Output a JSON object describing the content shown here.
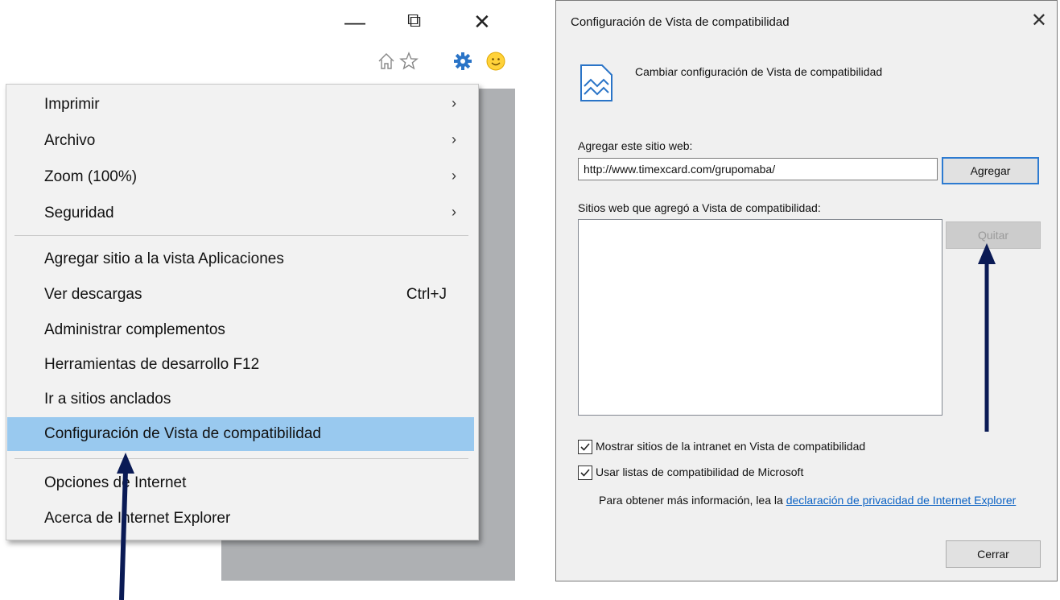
{
  "window_controls": {
    "minimize_glyph": "—",
    "restore_glyph": "⧉",
    "close_glyph": "✕"
  },
  "toolbar_icons": [
    "home-icon",
    "favorites-star-icon",
    "tools-gear-icon",
    "feedback-smiley-icon"
  ],
  "tools_menu": {
    "items": [
      {
        "label": "Imprimir",
        "submenu": "›"
      },
      {
        "label": "Archivo",
        "submenu": "›"
      },
      {
        "label": "Zoom (100%)",
        "submenu": "›"
      },
      {
        "label": "Seguridad",
        "submenu": "›"
      },
      {
        "label": "Agregar sitio a la vista Aplicaciones"
      },
      {
        "label": "Ver descargas",
        "shortcut": "Ctrl+J"
      },
      {
        "label": "Administrar complementos"
      },
      {
        "label": "Herramientas de desarrollo F12"
      },
      {
        "label": "Ir a sitios anclados"
      },
      {
        "label": "Configuración de Vista de compatibilidad",
        "highlighted": true
      },
      {
        "label": "Opciones de Internet"
      },
      {
        "label": "Acerca de Internet Explorer"
      }
    ]
  },
  "dialog": {
    "title": "Configuración de Vista de compatibilidad",
    "close_glyph": "✕",
    "header": "Cambiar configuración de Vista de compatibilidad",
    "add_label": "Agregar este sitio web:",
    "url_value": "http://www.timexcard.com/grupomaba/",
    "add_button": "Agregar",
    "list_label": "Sitios web que agregó a Vista de compatibilidad:",
    "remove_button": "Quitar",
    "checkbox_intranet": {
      "label": "Mostrar sitios de la intranet en Vista de compatibilidad",
      "checked": true
    },
    "checkbox_ms_lists": {
      "label": "Usar listas de compatibilidad de Microsoft",
      "checked": true
    },
    "info_prefix": "Para obtener más información, lea la ",
    "info_link": "declaración de privacidad de Internet Explorer",
    "close_button": "Cerrar"
  },
  "colors": {
    "menu_highlight": "#99c9ef",
    "arrow": "#0a1a55",
    "link": "#0b62c4",
    "focus_border": "#2d7bd1"
  }
}
